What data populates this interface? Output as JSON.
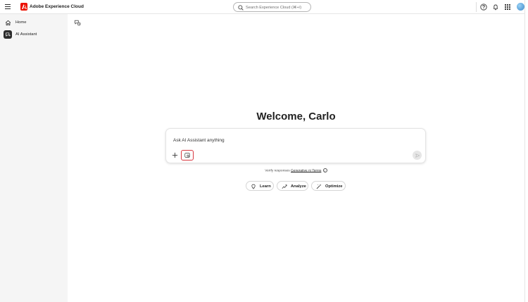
{
  "header": {
    "app_title": "Adobe Experience Cloud",
    "search_placeholder": "Search Experience Cloud (⌘+/)",
    "icons": [
      "menu-icon",
      "adobe-logo-icon",
      "search-icon",
      "help-icon",
      "bell-icon",
      "app-grid-icon",
      "avatar"
    ],
    "brand_color": "#eb1000"
  },
  "sidebar": {
    "items": [
      {
        "label": "Home",
        "icon": "home-icon"
      },
      {
        "label": "AI Assistant",
        "icon": "ai-assistant-icon",
        "selected": true
      }
    ]
  },
  "main": {
    "welcome": "Welcome, Carlo",
    "prompt_placeholder": "Ask AI Assistant anything",
    "verify_text": "Verify responses",
    "terms_link": "Generative AI Terms",
    "highlight_color": "#d7373f",
    "suggestions": [
      {
        "label": "Learn",
        "icon": "lightbulb-icon"
      },
      {
        "label": "Analyze",
        "icon": "trend-line-icon"
      },
      {
        "label": "Optimize",
        "icon": "magic-wand-icon"
      }
    ]
  }
}
